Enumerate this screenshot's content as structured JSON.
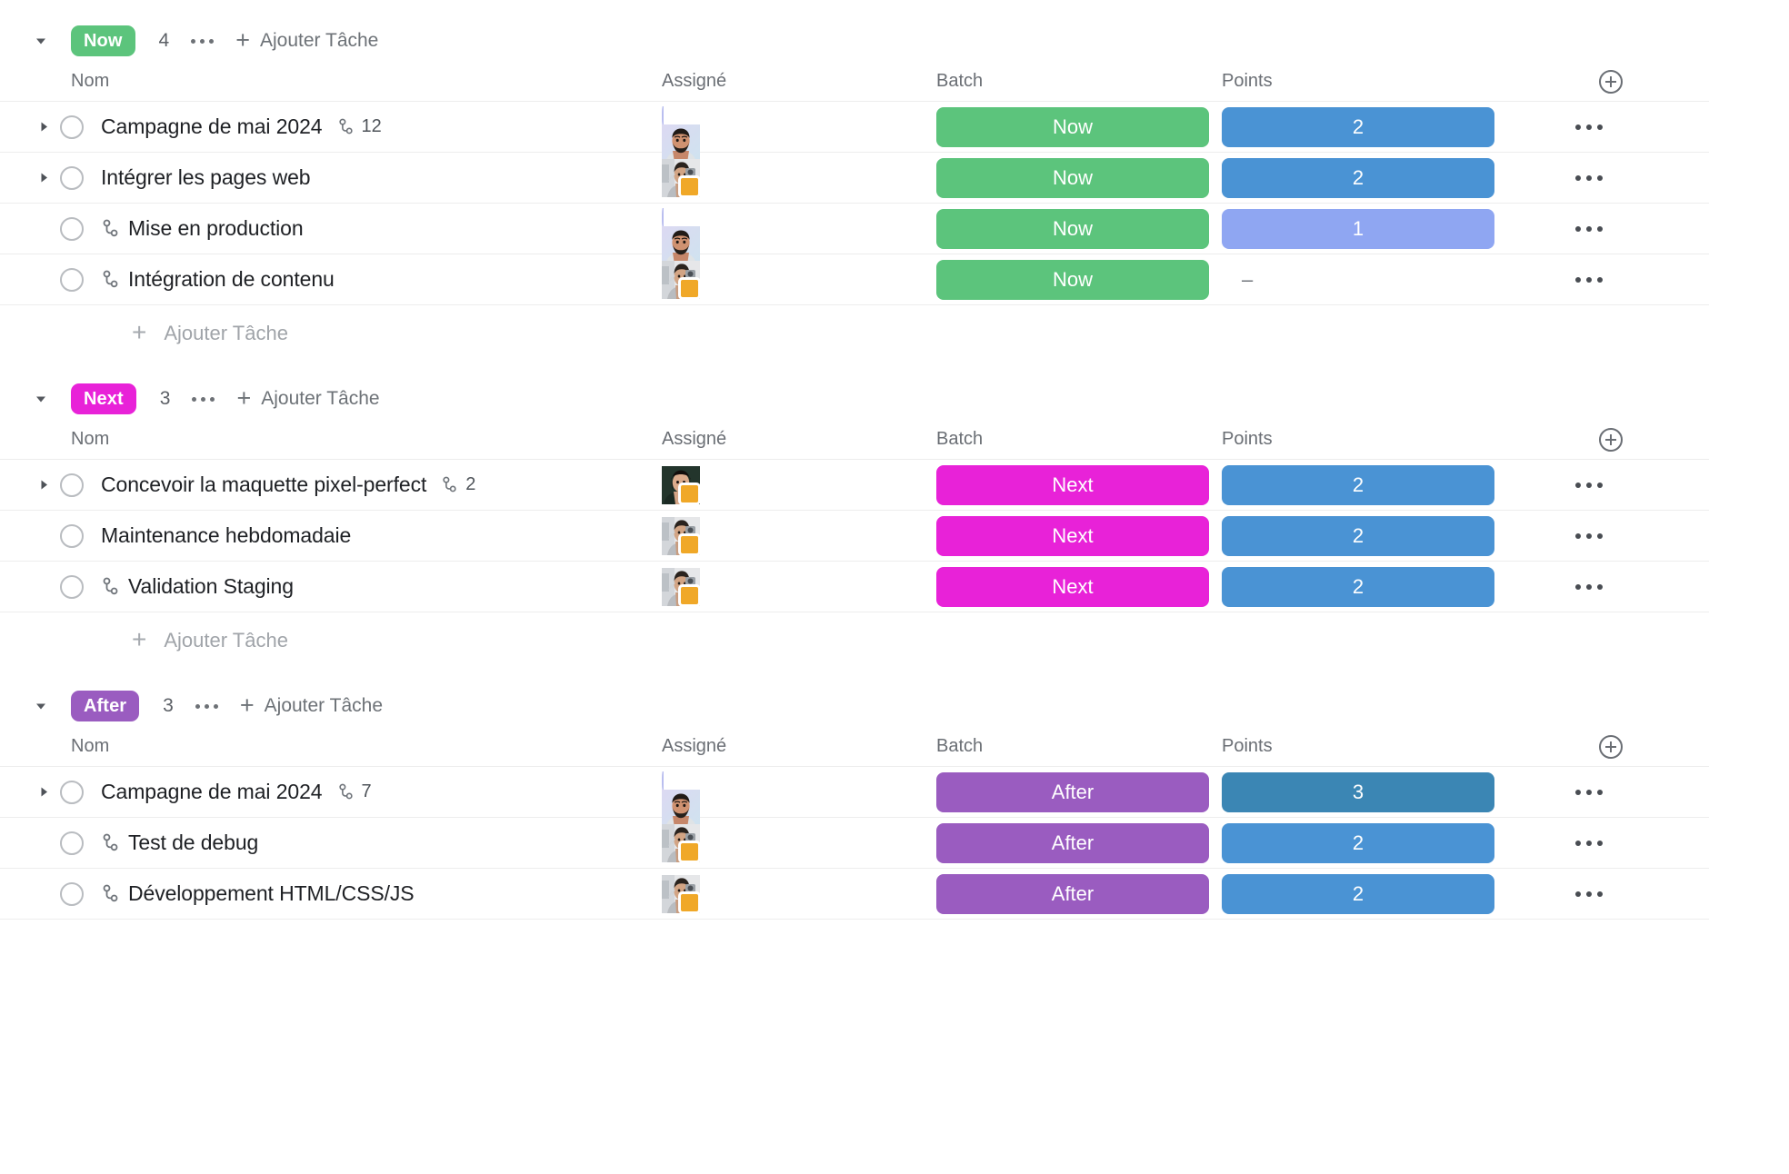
{
  "columns": {
    "name": "Nom",
    "assignee": "Assigné",
    "batch": "Batch",
    "points": "Points",
    "add_column_icon": "plus-circle-icon"
  },
  "labels": {
    "add_task": "Ajouter Tâche",
    "plus": "+",
    "dash": "–",
    "group_menu_icon": "ellipsis-icon",
    "row_menu_icon": "ellipsis-icon",
    "collapse_icon": "caret-down-icon",
    "expand_icon": "caret-right-icon",
    "subtask_icon": "subtask-branch-icon",
    "checkbox_icon": "circle-checkbox-icon"
  },
  "colors": {
    "now": "#5CC47C",
    "next": "#E822D8",
    "after": "#9A5CC0",
    "points_blue": "#4A93D4",
    "points_blue_light": "#8FA6F2",
    "points_blue_dark": "#3B86B4",
    "text_primary": "#1E2024",
    "text_muted": "#6A6E74",
    "border": "#EDEDED",
    "avatar_badge": "#F0A828"
  },
  "groups": [
    {
      "id": "now",
      "badge": "Now",
      "badge_color": "#5CC47C",
      "count": "4",
      "tasks": [
        {
          "name": "Campagne de mai 2024",
          "is_subtask": false,
          "expandable": true,
          "subtask_count": "12",
          "avatar": "man-beard",
          "avatar_ring": true,
          "avatar_badge": false,
          "batch": "Now",
          "batch_color": "#5CC47C",
          "points": "2",
          "points_color": "#4A93D4"
        },
        {
          "name": "Intégrer les pages web",
          "is_subtask": false,
          "expandable": true,
          "subtask_count": "",
          "avatar": "person-camera",
          "avatar_ring": false,
          "avatar_badge": true,
          "batch": "Now",
          "batch_color": "#5CC47C",
          "points": "2",
          "points_color": "#4A93D4"
        },
        {
          "name": "Mise en production",
          "is_subtask": true,
          "expandable": false,
          "subtask_count": "",
          "avatar": "man-beard",
          "avatar_ring": true,
          "avatar_badge": false,
          "batch": "Now",
          "batch_color": "#5CC47C",
          "points": "1",
          "points_color": "#8FA6F2"
        },
        {
          "name": "Intégration de contenu",
          "is_subtask": true,
          "expandable": false,
          "subtask_count": "",
          "avatar": "person-camera",
          "avatar_ring": false,
          "avatar_badge": true,
          "batch": "Now",
          "batch_color": "#5CC47C",
          "points": "",
          "points_color": ""
        }
      ]
    },
    {
      "id": "next",
      "badge": "Next",
      "badge_color": "#E822D8",
      "count": "3",
      "tasks": [
        {
          "name": "Concevoir la maquette pixel-perfect",
          "is_subtask": false,
          "expandable": true,
          "subtask_count": "2",
          "avatar": "woman-dark",
          "avatar_ring": false,
          "avatar_badge": true,
          "batch": "Next",
          "batch_color": "#E822D8",
          "points": "2",
          "points_color": "#4A93D4"
        },
        {
          "name": "Maintenance hebdomadaie",
          "is_subtask": false,
          "expandable": false,
          "subtask_count": "",
          "avatar": "person-camera",
          "avatar_ring": false,
          "avatar_badge": true,
          "batch": "Next",
          "batch_color": "#E822D8",
          "points": "2",
          "points_color": "#4A93D4"
        },
        {
          "name": "Validation Staging",
          "is_subtask": true,
          "expandable": false,
          "subtask_count": "",
          "avatar": "person-camera",
          "avatar_ring": false,
          "avatar_badge": true,
          "batch": "Next",
          "batch_color": "#E822D8",
          "points": "2",
          "points_color": "#4A93D4"
        }
      ]
    },
    {
      "id": "after",
      "badge": "After",
      "badge_color": "#9A5CC0",
      "count": "3",
      "tasks": [
        {
          "name": "Campagne de mai 2024",
          "is_subtask": false,
          "expandable": true,
          "subtask_count": "7",
          "avatar": "man-beard",
          "avatar_ring": true,
          "avatar_badge": false,
          "batch": "After",
          "batch_color": "#9A5CC0",
          "points": "3",
          "points_color": "#3B86B4"
        },
        {
          "name": "Test de debug",
          "is_subtask": true,
          "expandable": false,
          "subtask_count": "",
          "avatar": "person-camera",
          "avatar_ring": false,
          "avatar_badge": true,
          "batch": "After",
          "batch_color": "#9A5CC0",
          "points": "2",
          "points_color": "#4A93D4"
        },
        {
          "name": "Développement HTML/CSS/JS",
          "is_subtask": true,
          "expandable": false,
          "subtask_count": "",
          "avatar": "person-camera",
          "avatar_ring": false,
          "avatar_badge": true,
          "batch": "After",
          "batch_color": "#9A5CC0",
          "points": "2",
          "points_color": "#4A93D4"
        }
      ]
    }
  ]
}
